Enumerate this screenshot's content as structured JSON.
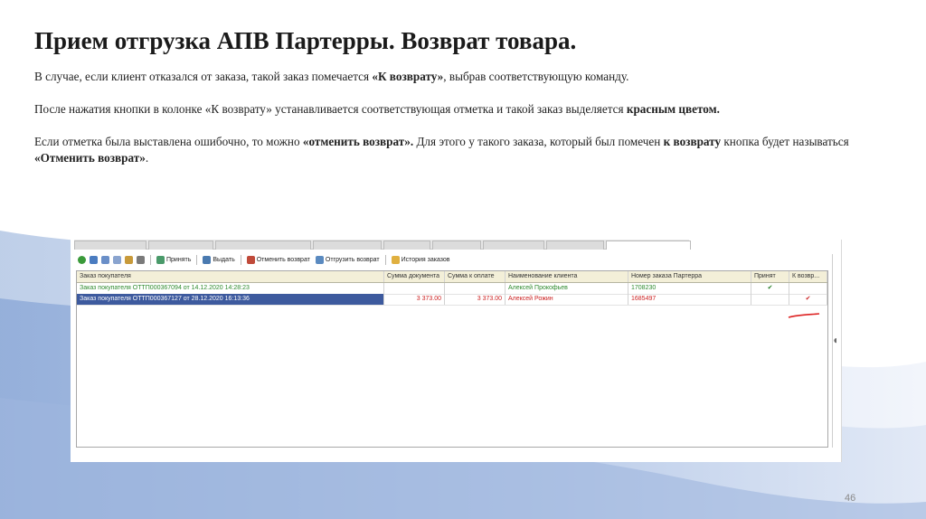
{
  "slide": {
    "title": "Прием отгрузка АПВ Партерры. Возврат товара.",
    "para1": {
      "pre": "В случае, если клиент отказался от заказа, такой заказ помечается ",
      "b1": "«К возврату»",
      "post": ", выбрав соответствующую команду."
    },
    "para2": {
      "pre": "После нажатия кнопки в колонке «К возврату» устанавливается соответствующая отметка и такой заказ выделяется ",
      "b1": "красным цветом."
    },
    "para3": {
      "pre": "Если отметка была выставлена ошибочно, то можно ",
      "b1": "«отменить возврат».",
      "mid": " Для этого у такого заказа, который был помечен ",
      "b2": "к возврату",
      "mid2": " кнопка будет называться ",
      "b3": "«Отменить возврат»",
      "post": "."
    },
    "page_number": "46"
  },
  "app": {
    "toolbar": {
      "accept": "Принять",
      "issue": "Выдать",
      "cancel_return": "Отменить возврат",
      "ship_return": "Отгрузить возврат",
      "history": "История заказов"
    },
    "table": {
      "headers": [
        "Заказ покупателя",
        "Сумма документа",
        "Сумма к оплате",
        "Наименование клиента",
        "Номер заказа Партерра",
        "Принят",
        "К возвр..."
      ],
      "rows": [
        {
          "order": "Заказ покупателя ОТТП000367094 от 14.12.2020 14:28:23",
          "doc_sum": "",
          "pay_sum": "",
          "client": "Алексей Прокофьев",
          "number": "1708230",
          "accepted": "✔",
          "return": ""
        },
        {
          "order": "Заказ покупателя ОТТП000367127 от 28.12.2020 16:13:36",
          "doc_sum": "3 373.00",
          "pay_sum": "3 373.00",
          "client": "Алексей Рожин",
          "number": "1685497",
          "accepted": "",
          "return": "✔"
        }
      ]
    }
  },
  "colors": {
    "accent_row": "#3d5a9e",
    "return_red": "#cc2222",
    "accepted_green": "#2d8a2d",
    "header_bg": "#f3efd8"
  }
}
